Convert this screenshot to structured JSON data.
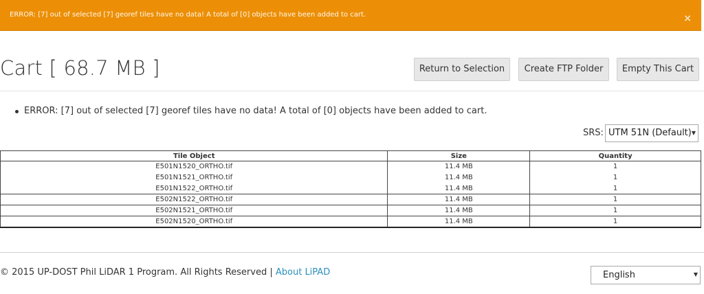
{
  "alert": {
    "text": "ERROR: [7] out of selected [7] georef tiles have no data! A total of [0] objects have been added to cart.",
    "close_symbol": "×",
    "color": "#ec8f07"
  },
  "page": {
    "title": "Cart [ 68.7 MB ]"
  },
  "buttons": {
    "return_label": "Return to Selection",
    "ftp_label": "Create FTP Folder",
    "empty_label": "Empty This Cart"
  },
  "messages": [
    "ERROR: [7] out of selected [7] georef tiles have no data! A total of [0] objects have been added to cart."
  ],
  "srs": {
    "label": "SRS:",
    "selected": "UTM 51N (Default)"
  },
  "table": {
    "headers": [
      "Tile Object",
      "Size",
      "Quantity"
    ],
    "rows": [
      [
        "E501N1520_ORTHO.tif",
        "11.4 MB",
        "1"
      ],
      [
        "E501N1521_ORTHO.tif",
        "11.4 MB",
        "1"
      ],
      [
        "E501N1522_ORTHO.tif",
        "11.4 MB",
        "1"
      ],
      [
        "E502N1522_ORTHO.tif",
        "11.4 MB",
        "1"
      ],
      [
        "E502N1521_ORTHO.tif",
        "11.4 MB",
        "1"
      ],
      [
        "E502N1520_ORTHO.tif",
        "11.4 MB",
        "1"
      ]
    ]
  },
  "footer": {
    "copyright": "© 2015 UP-DOST Phil LiDAR 1 Program. All Rights Reserved | ",
    "link": "About LiPAD",
    "link_color": "#2a8fbd"
  },
  "language": {
    "selected": "English"
  }
}
